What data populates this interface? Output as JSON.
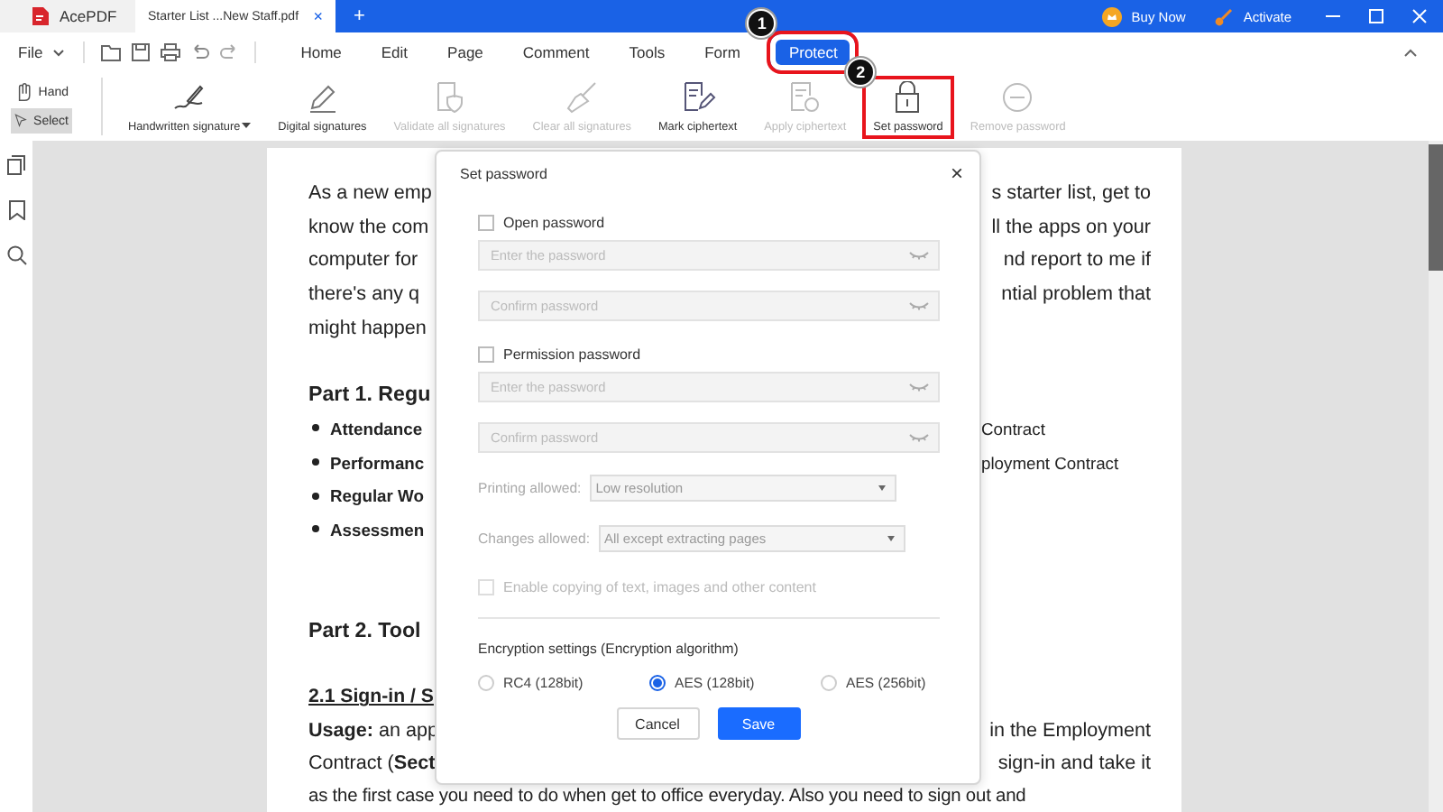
{
  "app": {
    "name": "AcePDF"
  },
  "document_tab": {
    "title": "Starter List ...New Staff.pdf",
    "close": "×"
  },
  "new_tab": "+",
  "title_actions": [
    {
      "label": "Buy Now",
      "kind": "crown"
    },
    {
      "label": "Activate",
      "kind": "key"
    }
  ],
  "menu": {
    "file": "File",
    "tabs": [
      {
        "label": "Home",
        "selected": false,
        "highlighted": false
      },
      {
        "label": "Edit",
        "selected": false,
        "highlighted": false
      },
      {
        "label": "Page",
        "selected": false,
        "highlighted": false
      },
      {
        "label": "Comment",
        "selected": false,
        "highlighted": false
      },
      {
        "label": "Tools",
        "selected": false,
        "highlighted": false
      },
      {
        "label": "Form",
        "selected": false,
        "highlighted": false
      },
      {
        "label": "Protect",
        "selected": true,
        "highlighted": true,
        "step": "1"
      }
    ]
  },
  "modes": [
    {
      "label": "Hand",
      "kind": "hand",
      "selected": false
    },
    {
      "label": "Select",
      "kind": "select",
      "selected": true
    }
  ],
  "tools": [
    {
      "label": "Handwritten signature",
      "kind": "pen",
      "dropdown": true,
      "disabled": false,
      "highlighted": false
    },
    {
      "label": "Digital signatures",
      "kind": "pencil",
      "dropdown": false,
      "disabled": false,
      "highlighted": false
    },
    {
      "label": "Validate all signatures",
      "kind": "validate",
      "dropdown": false,
      "disabled": true,
      "highlighted": false
    },
    {
      "label": "Clear all signatures",
      "kind": "brush",
      "dropdown": false,
      "disabled": true,
      "highlighted": false
    },
    {
      "label": "Mark ciphertext",
      "kind": "mark",
      "dropdown": false,
      "disabled": false,
      "highlighted": false
    },
    {
      "label": "Apply ciphertext",
      "kind": "apply",
      "dropdown": false,
      "disabled": true,
      "highlighted": false
    },
    {
      "label": "Set password",
      "kind": "lock",
      "dropdown": false,
      "disabled": false,
      "highlighted": true,
      "step": "2"
    },
    {
      "label": "Remove password",
      "kind": "remove",
      "dropdown": false,
      "disabled": true,
      "highlighted": false
    }
  ],
  "document": {
    "lines": [
      {
        "kind": "para",
        "left": "As a new emp",
        "right": "s starter list, get to"
      },
      {
        "kind": "para",
        "left": "know the com",
        "right": "ll the apps on your"
      },
      {
        "kind": "para",
        "left": "computer for",
        "right": "nd report to me if"
      },
      {
        "kind": "para",
        "left": "there's any q",
        "right": "ntial problem that"
      },
      {
        "kind": "para",
        "left": "might happen"
      },
      {
        "kind": "gap"
      },
      {
        "kind": "heading",
        "left": "Part 1. Regu"
      },
      {
        "kind": "bullet",
        "left": "Attendance",
        "right": "Contract"
      },
      {
        "kind": "bullet",
        "left": "Performanc",
        "right": "ployment Contract"
      },
      {
        "kind": "bullet",
        "left": "Regular Wo"
      },
      {
        "kind": "bullet",
        "left": "Assessmen"
      },
      {
        "kind": "gap"
      },
      {
        "kind": "gap"
      },
      {
        "kind": "heading",
        "left": "Part 2. Tool"
      },
      {
        "kind": "gap"
      },
      {
        "kind": "subheading",
        "left": "2.1 Sign-in / S"
      },
      {
        "kind": "para",
        "left": "**Usage:** an app",
        "right": "in the Employment"
      },
      {
        "kind": "para",
        "left": "Contract (**Sect**",
        "right": "sign-in and take it"
      },
      {
        "kind": "full",
        "left": "as the first case you need to do when get to office everyday. Also you need to sign out and"
      }
    ]
  },
  "dialog": {
    "title": "Set password",
    "close": "×",
    "sections": [
      {
        "checkbox": {
          "label": "Open password",
          "checked": false
        },
        "fields": [
          {
            "placeholder": "Enter the password"
          },
          {
            "placeholder": "Confirm password"
          }
        ]
      },
      {
        "checkbox": {
          "label": "Permission password",
          "checked": false
        },
        "fields": [
          {
            "placeholder": "Enter the password"
          },
          {
            "placeholder": "Confirm password"
          }
        ]
      }
    ],
    "selects": [
      {
        "label": "Printing allowed:",
        "value": "Low resolution"
      },
      {
        "label": "Changes allowed:",
        "value": "All except extracting pages"
      }
    ],
    "copy_option": {
      "label": "Enable copying of text, images and other content",
      "checked": false,
      "disabled": true
    },
    "encryption_label": "Encryption settings (Encryption algorithm)",
    "algorithms": [
      {
        "label": "RC4 (128bit)",
        "selected": false
      },
      {
        "label": "AES (128bit)",
        "selected": true
      },
      {
        "label": "AES (256bit)",
        "selected": false
      }
    ],
    "buttons": [
      {
        "label": "Cancel",
        "kind": "secondary"
      },
      {
        "label": "Save",
        "kind": "primary"
      }
    ]
  }
}
